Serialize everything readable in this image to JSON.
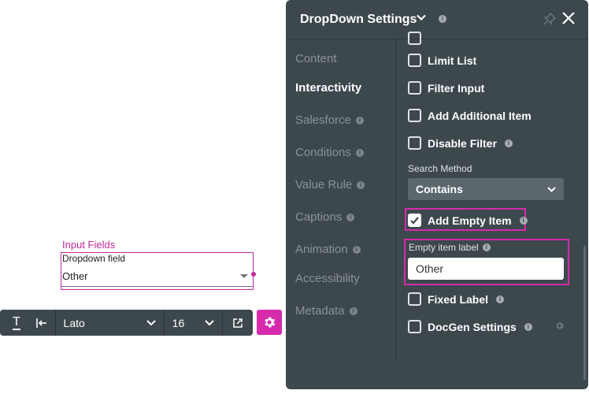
{
  "canvas": {
    "group_label": "Input Fields",
    "field_title": "Dropdown field",
    "field_value": "Other"
  },
  "toolbar": {
    "text_icon": "text-format-icon",
    "indent_icon": "indent-icon",
    "font": "Lato",
    "size": "16",
    "open_icon": "external-link-icon",
    "gear_icon": "gear-icon"
  },
  "panel": {
    "title": "DropDown Settings",
    "nav": [
      {
        "label": "Content",
        "active": false,
        "info": false
      },
      {
        "label": "Interactivity",
        "active": true,
        "info": false
      },
      {
        "label": "Salesforce",
        "active": false,
        "info": true
      },
      {
        "label": "Conditions",
        "active": false,
        "info": true
      },
      {
        "label": "Value Rule",
        "active": false,
        "info": true
      },
      {
        "label": "Captions",
        "active": false,
        "info": true
      },
      {
        "label": "Animation",
        "active": false,
        "info": true
      },
      {
        "label": "Accessibility",
        "active": false,
        "info": false
      },
      {
        "label": "Metadata",
        "active": false,
        "info": true
      }
    ],
    "options": {
      "limit_list": "Limit List",
      "filter_input": "Filter Input",
      "add_additional_item": "Add Additional Item",
      "disable_filter": "Disable Filter",
      "search_method_label": "Search Method",
      "search_method_value": "Contains",
      "add_empty_item": "Add Empty Item",
      "empty_item_label": "Empty item label",
      "empty_item_value": "Other",
      "fixed_label": "Fixed Label",
      "docgen_settings": "DocGen Settings"
    },
    "info_glyph": "i",
    "colors": {
      "panel_bg": "#3d484d",
      "accent": "#d62bab",
      "canvas_accent": "#c2299e"
    }
  }
}
